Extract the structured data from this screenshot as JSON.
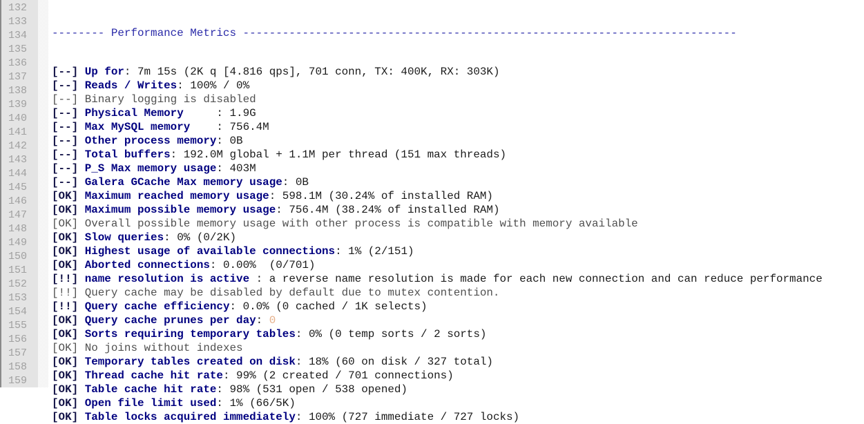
{
  "editor": {
    "line_numbers": [
      "132",
      "133",
      "134",
      "135",
      "136",
      "137",
      "138",
      "139",
      "140",
      "141",
      "142",
      "143",
      "144",
      "145",
      "146",
      "147",
      "148",
      "149",
      "150",
      "151",
      "152",
      "153",
      "154",
      "155",
      "156",
      "157",
      "158",
      "159"
    ],
    "header": "-------- Performance Metrics ---------------------------------------------------------------------------",
    "lines": [
      {
        "tag": "[--]",
        "label": "Up for",
        "sep": ": ",
        "value": "7m 15s (2K q [4.816 qps], 701 conn, TX: 400K, RX: 303K)"
      },
      {
        "tag": "[--]",
        "label": "Reads / Writes",
        "sep": ": ",
        "value": "100% / 0%"
      },
      {
        "tag": "[--]",
        "plain": "Binary logging is disabled"
      },
      {
        "tag": "[--]",
        "label": "Physical Memory     ",
        "sep": ": ",
        "value": "1.9G"
      },
      {
        "tag": "[--]",
        "label": "Max MySQL memory    ",
        "sep": ": ",
        "value": "756.4M"
      },
      {
        "tag": "[--]",
        "label": "Other process memory",
        "sep": ": ",
        "value": "0B"
      },
      {
        "tag": "[--]",
        "label": "Total buffers",
        "sep": ": ",
        "value": "192.0M global + 1.1M per thread (151 max threads)"
      },
      {
        "tag": "[--]",
        "label": "P_S Max memory usage",
        "sep": ": ",
        "value": "403M"
      },
      {
        "tag": "[--]",
        "label": "Galera GCache Max memory usage",
        "sep": ": ",
        "value": "0B"
      },
      {
        "tag": "[OK]",
        "label": "Maximum reached memory usage",
        "sep": ": ",
        "value": "598.1M (30.24% of installed RAM)"
      },
      {
        "tag": "[OK]",
        "label": "Maximum possible memory usage",
        "sep": ": ",
        "value": "756.4M (38.24% of installed RAM)"
      },
      {
        "tag": "[OK]",
        "plain": "Overall possible memory usage with other process is compatible with memory available"
      },
      {
        "tag": "[OK]",
        "label": "Slow queries",
        "sep": ": ",
        "value": "0% (0/2K)"
      },
      {
        "tag": "[OK]",
        "label": "Highest usage of available connections",
        "sep": ": ",
        "value": "1% (2/151)"
      },
      {
        "tag": "[OK]",
        "label": "Aborted connections",
        "sep": ": ",
        "value": "0.00%  (0/701)"
      },
      {
        "tag": "[!!]",
        "label": "name resolution is active ",
        "sep": ": ",
        "value": "a reverse name resolution is made for each new connection and can reduce performance"
      },
      {
        "tag": "[!!]",
        "plain": "Query cache may be disabled by default due to mutex contention."
      },
      {
        "tag": "[!!]",
        "label": "Query cache efficiency",
        "sep": ": ",
        "value": "0.0% (0 cached / 1K selects)"
      },
      {
        "tag": "[OK]",
        "label": "Query cache prunes per day",
        "sep": ": ",
        "value_orange": "0"
      },
      {
        "tag": "[OK]",
        "label": "Sorts requiring temporary tables",
        "sep": ": ",
        "value": "0% (0 temp sorts / 2 sorts)"
      },
      {
        "tag": "[OK]",
        "plain": "No joins without indexes"
      },
      {
        "tag": "[OK]",
        "label": "Temporary tables created on disk",
        "sep": ": ",
        "value": "18% (60 on disk / 327 total)"
      },
      {
        "tag": "[OK]",
        "label": "Thread cache hit rate",
        "sep": ": ",
        "value": "99% (2 created / 701 connections)"
      },
      {
        "tag": "[OK]",
        "label": "Table cache hit rate",
        "sep": ": ",
        "value": "98% (531 open / 538 opened)"
      },
      {
        "tag": "[OK]",
        "label": "Open file limit used",
        "sep": ": ",
        "value": "1% (66/5K)"
      },
      {
        "tag": "[OK]",
        "label": "Table locks acquired immediately",
        "sep": ": ",
        "value": "100% (727 immediate / 727 locks)"
      }
    ]
  },
  "colors": {
    "header": "#2a2aa8",
    "label": "#000080",
    "plain_line": "#505050",
    "prunes_value": "#e6b08a",
    "gutter_bg": "#e4e4e4",
    "line_number": "#a0a0a0"
  }
}
